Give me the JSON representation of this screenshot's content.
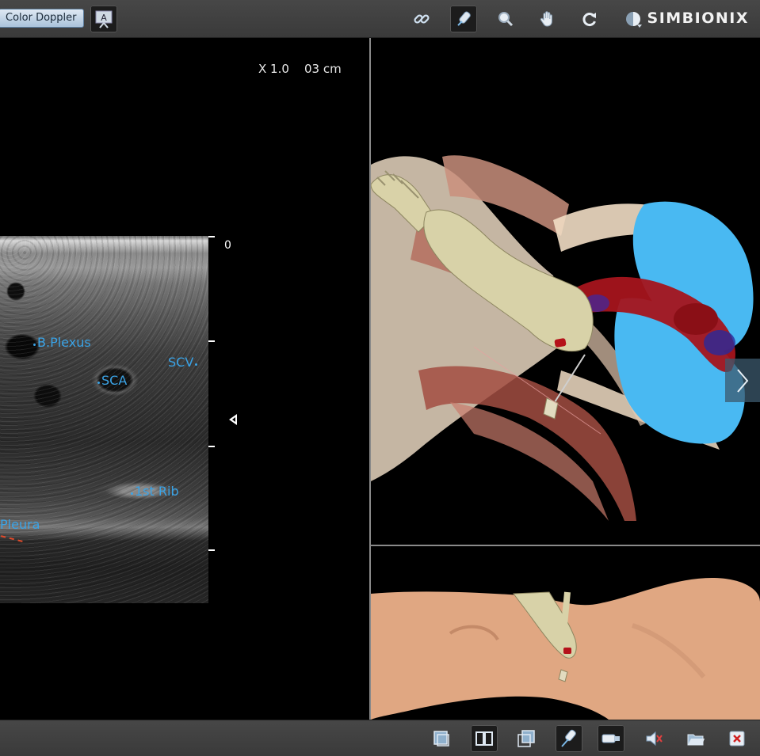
{
  "toolbar": {
    "color_doppler_label": "Color Doppler",
    "annotation_icon_letter": "A",
    "brand": "SIMBIONIX",
    "right_icons": [
      "link-icon",
      "probe-icon",
      "zoom-icon",
      "pan-hand-icon",
      "rotate-icon",
      "brightness-icon"
    ],
    "active_icon": "probe-icon"
  },
  "ultrasound": {
    "zoom_label": "X 1.0",
    "depth_label": "03 cm",
    "depth_zero": "0",
    "labels": {
      "plexus": "B.Plexus",
      "sca": "SCA",
      "scv": "SCV",
      "rib": "1st Rib",
      "pleura": "Pleura"
    },
    "label_color": "#3aa3e6",
    "needle_trace_color": "#e04a2a"
  },
  "anatomy_view": {
    "next_icon": "chevron-right-icon"
  },
  "bottom_toolbar": {
    "icons": [
      "single-view-icon",
      "split-view-icon",
      "overlay-view-icon",
      "needle-probe-icon",
      "camera-probe-icon",
      "speaker-muted-icon",
      "open-folder-icon",
      "close-icon"
    ],
    "active_icons": [
      "split-view-icon",
      "needle-probe-icon",
      "camera-probe-icon"
    ]
  }
}
